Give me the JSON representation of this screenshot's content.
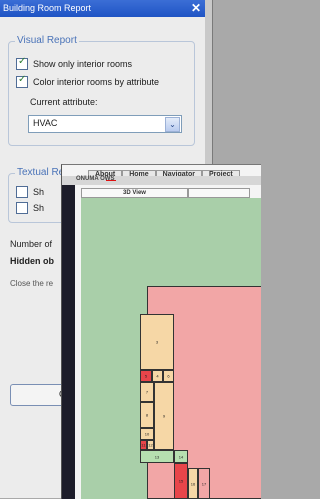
{
  "dialog": {
    "title": "Building Room Report",
    "close_glyph": "✕",
    "visual_group": {
      "legend": "Visual Report",
      "show_interior_label": "Show only interior rooms",
      "show_interior_checked": true,
      "color_by_attr_label": "Color interior rooms by attribute",
      "color_by_attr_checked": true,
      "current_attr_label": "Current attribute:",
      "attr_value": "HVAC",
      "dropdown_glyph": "⌄"
    },
    "textual_group": {
      "legend": "Textual Report",
      "option1_label": "Sh",
      "option1_checked": false,
      "option2_label": "Sh",
      "option2_checked": false
    },
    "number_label": "Number of",
    "hidden_label": "Hidden ob",
    "close_hint": "Close the re",
    "button_label": "C"
  },
  "browser": {
    "nav": [
      "About",
      "Home",
      "Navigator",
      "Project"
    ],
    "brand": "ONUMA OWS",
    "tab_3d": "3D View",
    "rooms": [
      "3",
      "5",
      "4",
      "6",
      "7",
      "8",
      "9",
      "10",
      "11",
      "12",
      "13",
      "14",
      "15",
      "16",
      "17"
    ]
  },
  "colors": {
    "title_bar": "#2459c8",
    "legend_text": "#4a73b8",
    "canvas_bg": "#a9cfa9",
    "room_peach": "#f6d7a6",
    "room_pink": "#f2a6a6",
    "room_red": "#e8454a",
    "room_green": "#b6e0b0"
  }
}
